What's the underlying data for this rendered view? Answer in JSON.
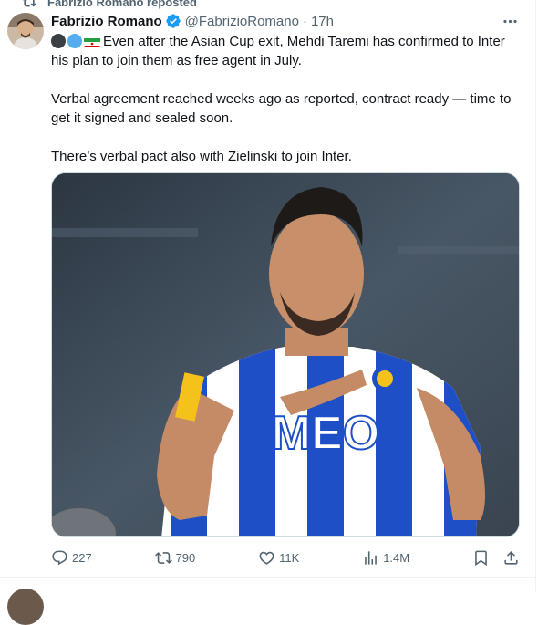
{
  "repost": {
    "label": "Fabrizio Romano reposted",
    "icon": "repost-icon"
  },
  "author": {
    "name": "Fabrizio Romano",
    "handle": "@FabrizioRomano",
    "separator": "·",
    "time": "17h",
    "verified": true
  },
  "tweet": {
    "paragraph1": "Even after the Asian Cup exit, Mehdi Taremi has confirmed to Inter his plan to join them as free agent in July.",
    "paragraph2": "Verbal agreement reached weeks ago as reported, contract ready — time to get it signed and sealed soon.",
    "paragraph3": "There’s verbal pact also with Zielinski to join Inter.",
    "emojis": [
      "black-circle",
      "blue-circle",
      "iran-flag"
    ]
  },
  "media": {
    "shirt_sponsor": "MEO"
  },
  "actions": {
    "replies": "227",
    "reposts": "790",
    "likes": "11K",
    "views": "1.4M"
  },
  "colors": {
    "text": "#0f1419",
    "secondary": "#536471",
    "verified_blue": "#1d9bf0",
    "border": "#cfd9de"
  }
}
